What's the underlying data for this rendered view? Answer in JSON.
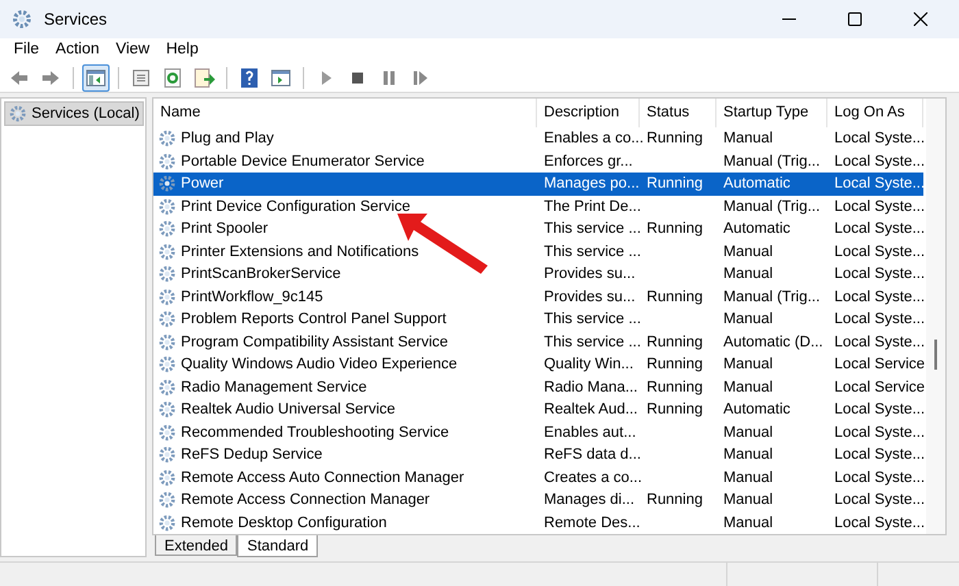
{
  "window": {
    "title": "Services"
  },
  "menu": [
    "File",
    "Action",
    "View",
    "Help"
  ],
  "toolbar": [
    {
      "kind": "back",
      "pressed": false
    },
    {
      "kind": "forward",
      "pressed": false
    },
    {
      "kind": "sep"
    },
    {
      "kind": "tree",
      "pressed": true
    },
    {
      "kind": "sep"
    },
    {
      "kind": "properties",
      "pressed": false
    },
    {
      "kind": "refresh",
      "pressed": false
    },
    {
      "kind": "export",
      "pressed": false
    },
    {
      "kind": "sep"
    },
    {
      "kind": "help",
      "pressed": false
    },
    {
      "kind": "view",
      "pressed": false
    },
    {
      "kind": "sep"
    },
    {
      "kind": "start",
      "pressed": false
    },
    {
      "kind": "stop",
      "pressed": false
    },
    {
      "kind": "pause",
      "pressed": false
    },
    {
      "kind": "resume",
      "pressed": false
    }
  ],
  "tree": {
    "label": "Services (Local)",
    "selected": true
  },
  "table": {
    "columns": [
      "Name",
      "Description",
      "Status",
      "Startup Type",
      "Log On As"
    ],
    "rows": [
      {
        "cells": [
          "Plug and Play",
          "Enables a co...",
          "Running",
          "Manual",
          "Local Syste..."
        ],
        "selected": false
      },
      {
        "cells": [
          "Portable Device Enumerator Service",
          "Enforces gr...",
          "",
          "Manual (Trig...",
          "Local Syste..."
        ],
        "selected": false
      },
      {
        "cells": [
          "Power",
          "Manages po...",
          "Running",
          "Automatic",
          "Local Syste..."
        ],
        "selected": true
      },
      {
        "cells": [
          "Print Device Configuration Service",
          "The Print De...",
          "",
          "Manual (Trig...",
          "Local Syste..."
        ],
        "selected": false
      },
      {
        "cells": [
          "Print Spooler",
          "This service ...",
          "Running",
          "Automatic",
          "Local Syste..."
        ],
        "selected": false
      },
      {
        "cells": [
          "Printer Extensions and Notifications",
          "This service ...",
          "",
          "Manual",
          "Local Syste..."
        ],
        "selected": false
      },
      {
        "cells": [
          "PrintScanBrokerService",
          "Provides su...",
          "",
          "Manual",
          "Local Syste..."
        ],
        "selected": false
      },
      {
        "cells": [
          "PrintWorkflow_9c145",
          "Provides su...",
          "Running",
          "Manual (Trig...",
          "Local Syste..."
        ],
        "selected": false
      },
      {
        "cells": [
          "Problem Reports Control Panel Support",
          "This service ...",
          "",
          "Manual",
          "Local Syste..."
        ],
        "selected": false
      },
      {
        "cells": [
          "Program Compatibility Assistant Service",
          "This service ...",
          "Running",
          "Automatic (D...",
          "Local Syste..."
        ],
        "selected": false
      },
      {
        "cells": [
          "Quality Windows Audio Video Experience",
          "Quality Win...",
          "Running",
          "Manual",
          "Local Service"
        ],
        "selected": false
      },
      {
        "cells": [
          "Radio Management Service",
          "Radio Mana...",
          "Running",
          "Manual",
          "Local Service"
        ],
        "selected": false
      },
      {
        "cells": [
          "Realtek Audio Universal Service",
          "Realtek Aud...",
          "Running",
          "Automatic",
          "Local Syste..."
        ],
        "selected": false
      },
      {
        "cells": [
          "Recommended Troubleshooting Service",
          "Enables aut...",
          "",
          "Manual",
          "Local Syste..."
        ],
        "selected": false
      },
      {
        "cells": [
          "ReFS Dedup Service",
          "ReFS data d...",
          "",
          "Manual",
          "Local Syste..."
        ],
        "selected": false
      },
      {
        "cells": [
          "Remote Access Auto Connection Manager",
          "Creates a co...",
          "",
          "Manual",
          "Local Syste..."
        ],
        "selected": false
      },
      {
        "cells": [
          "Remote Access Connection Manager",
          "Manages di...",
          "Running",
          "Manual",
          "Local Syste..."
        ],
        "selected": false
      },
      {
        "cells": [
          "Remote Desktop Configuration",
          "Remote Des...",
          "",
          "Manual",
          "Local Syste..."
        ],
        "selected": false
      }
    ]
  },
  "tabs": [
    {
      "label": "Extended",
      "selected": false
    },
    {
      "label": "Standard",
      "selected": true
    }
  ]
}
